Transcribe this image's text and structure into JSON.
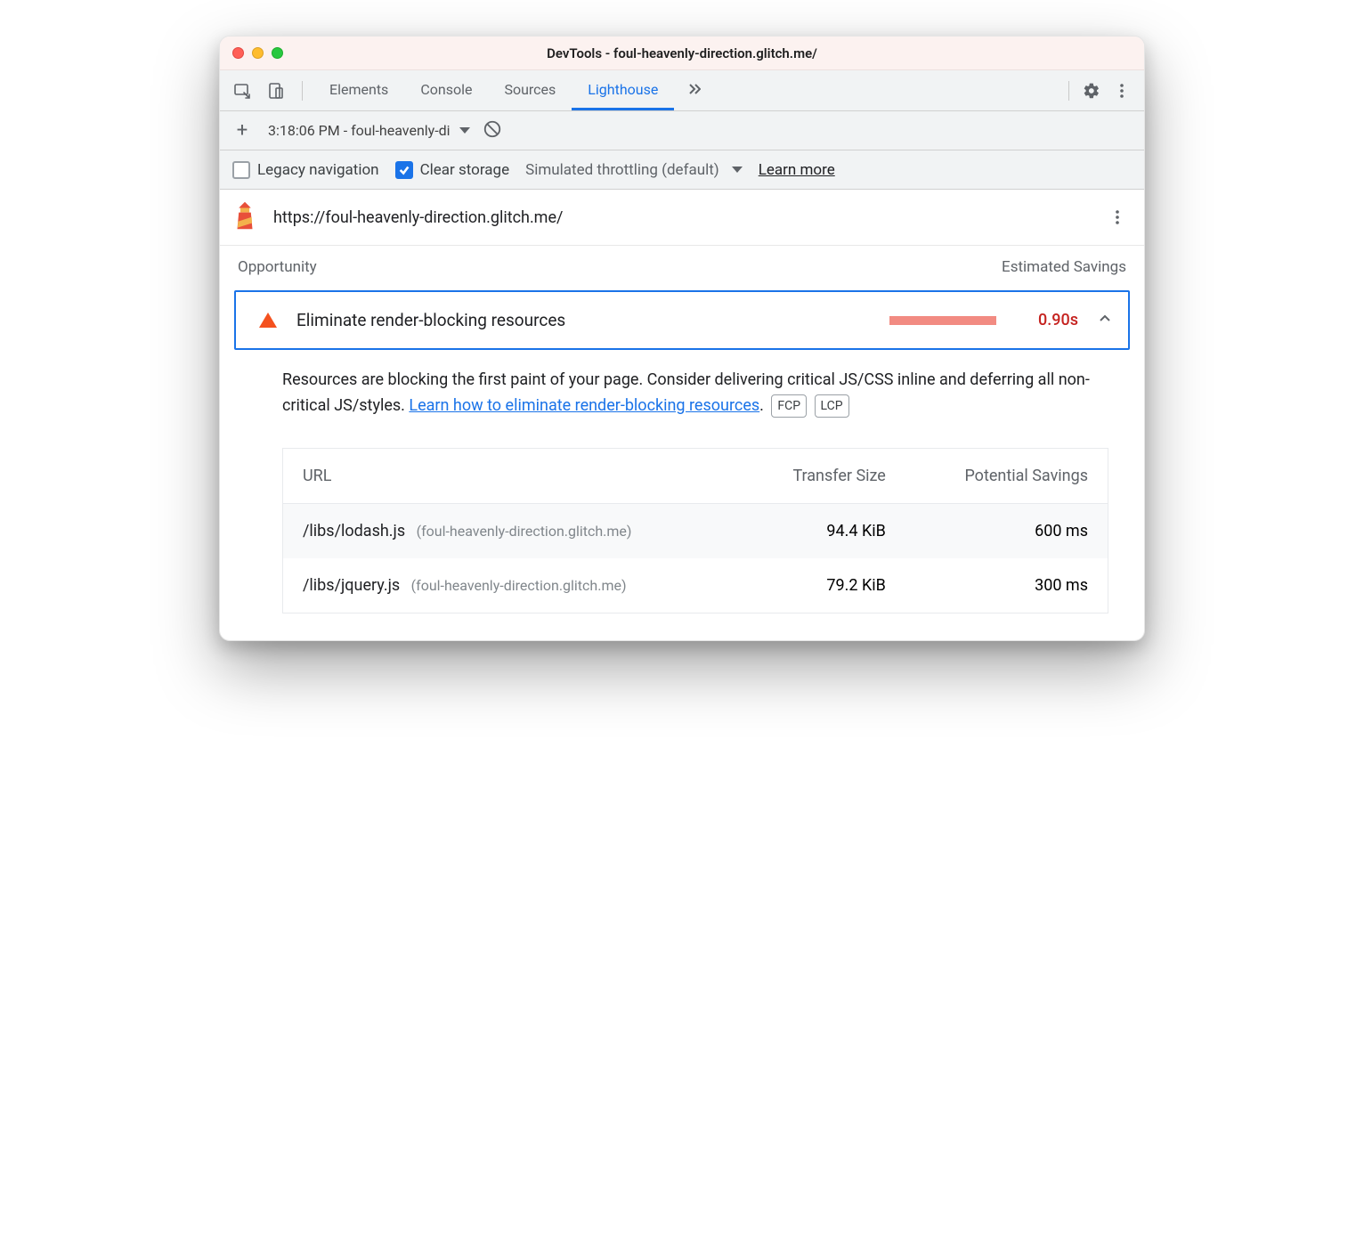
{
  "window": {
    "title": "DevTools - foul-heavenly-direction.glitch.me/"
  },
  "tabs": {
    "items": [
      "Elements",
      "Console",
      "Sources",
      "Lighthouse"
    ],
    "active": "Lighthouse"
  },
  "subbar": {
    "report_label": "3:18:06 PM - foul-heavenly-di"
  },
  "options": {
    "legacy_label": "Legacy navigation",
    "legacy_checked": false,
    "clear_label": "Clear storage",
    "clear_checked": true,
    "throttling_label": "Simulated throttling (default)",
    "learn_more": "Learn more"
  },
  "urlbar": {
    "url": "https://foul-heavenly-direction.glitch.me/"
  },
  "section": {
    "opportunity": "Opportunity",
    "savings": "Estimated Savings"
  },
  "audit": {
    "title": "Eliminate render-blocking resources",
    "savings": "0.90s",
    "description_pre": "Resources are blocking the first paint of your page. Consider delivering critical JS/CSS inline and deferring all non-critical JS/styles. ",
    "link_text": "Learn how to eliminate render-blocking resources",
    "description_post": ".",
    "badges": [
      "FCP",
      "LCP"
    ]
  },
  "table": {
    "headers": {
      "url": "URL",
      "size": "Transfer Size",
      "savings": "Potential Savings"
    },
    "rows": [
      {
        "path": "/libs/lodash.js",
        "host": "(foul-heavenly-direction.glitch.me)",
        "size": "94.4 KiB",
        "savings": "600 ms"
      },
      {
        "path": "/libs/jquery.js",
        "host": "(foul-heavenly-direction.glitch.me)",
        "size": "79.2 KiB",
        "savings": "300 ms"
      }
    ]
  }
}
